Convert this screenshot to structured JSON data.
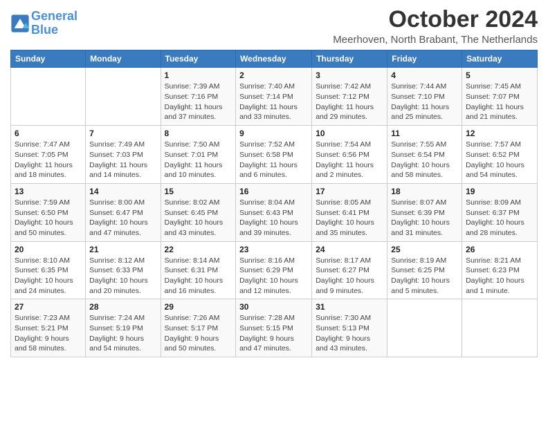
{
  "logo": {
    "line1": "General",
    "line2": "Blue"
  },
  "title": "October 2024",
  "location": "Meerhoven, North Brabant, The Netherlands",
  "days_header": [
    "Sunday",
    "Monday",
    "Tuesday",
    "Wednesday",
    "Thursday",
    "Friday",
    "Saturday"
  ],
  "weeks": [
    [
      {
        "num": "",
        "detail": ""
      },
      {
        "num": "",
        "detail": ""
      },
      {
        "num": "1",
        "detail": "Sunrise: 7:39 AM\nSunset: 7:16 PM\nDaylight: 11 hours and 37 minutes."
      },
      {
        "num": "2",
        "detail": "Sunrise: 7:40 AM\nSunset: 7:14 PM\nDaylight: 11 hours and 33 minutes."
      },
      {
        "num": "3",
        "detail": "Sunrise: 7:42 AM\nSunset: 7:12 PM\nDaylight: 11 hours and 29 minutes."
      },
      {
        "num": "4",
        "detail": "Sunrise: 7:44 AM\nSunset: 7:10 PM\nDaylight: 11 hours and 25 minutes."
      },
      {
        "num": "5",
        "detail": "Sunrise: 7:45 AM\nSunset: 7:07 PM\nDaylight: 11 hours and 21 minutes."
      }
    ],
    [
      {
        "num": "6",
        "detail": "Sunrise: 7:47 AM\nSunset: 7:05 PM\nDaylight: 11 hours and 18 minutes."
      },
      {
        "num": "7",
        "detail": "Sunrise: 7:49 AM\nSunset: 7:03 PM\nDaylight: 11 hours and 14 minutes."
      },
      {
        "num": "8",
        "detail": "Sunrise: 7:50 AM\nSunset: 7:01 PM\nDaylight: 11 hours and 10 minutes."
      },
      {
        "num": "9",
        "detail": "Sunrise: 7:52 AM\nSunset: 6:58 PM\nDaylight: 11 hours and 6 minutes."
      },
      {
        "num": "10",
        "detail": "Sunrise: 7:54 AM\nSunset: 6:56 PM\nDaylight: 11 hours and 2 minutes."
      },
      {
        "num": "11",
        "detail": "Sunrise: 7:55 AM\nSunset: 6:54 PM\nDaylight: 10 hours and 58 minutes."
      },
      {
        "num": "12",
        "detail": "Sunrise: 7:57 AM\nSunset: 6:52 PM\nDaylight: 10 hours and 54 minutes."
      }
    ],
    [
      {
        "num": "13",
        "detail": "Sunrise: 7:59 AM\nSunset: 6:50 PM\nDaylight: 10 hours and 50 minutes."
      },
      {
        "num": "14",
        "detail": "Sunrise: 8:00 AM\nSunset: 6:47 PM\nDaylight: 10 hours and 47 minutes."
      },
      {
        "num": "15",
        "detail": "Sunrise: 8:02 AM\nSunset: 6:45 PM\nDaylight: 10 hours and 43 minutes."
      },
      {
        "num": "16",
        "detail": "Sunrise: 8:04 AM\nSunset: 6:43 PM\nDaylight: 10 hours and 39 minutes."
      },
      {
        "num": "17",
        "detail": "Sunrise: 8:05 AM\nSunset: 6:41 PM\nDaylight: 10 hours and 35 minutes."
      },
      {
        "num": "18",
        "detail": "Sunrise: 8:07 AM\nSunset: 6:39 PM\nDaylight: 10 hours and 31 minutes."
      },
      {
        "num": "19",
        "detail": "Sunrise: 8:09 AM\nSunset: 6:37 PM\nDaylight: 10 hours and 28 minutes."
      }
    ],
    [
      {
        "num": "20",
        "detail": "Sunrise: 8:10 AM\nSunset: 6:35 PM\nDaylight: 10 hours and 24 minutes."
      },
      {
        "num": "21",
        "detail": "Sunrise: 8:12 AM\nSunset: 6:33 PM\nDaylight: 10 hours and 20 minutes."
      },
      {
        "num": "22",
        "detail": "Sunrise: 8:14 AM\nSunset: 6:31 PM\nDaylight: 10 hours and 16 minutes."
      },
      {
        "num": "23",
        "detail": "Sunrise: 8:16 AM\nSunset: 6:29 PM\nDaylight: 10 hours and 12 minutes."
      },
      {
        "num": "24",
        "detail": "Sunrise: 8:17 AM\nSunset: 6:27 PM\nDaylight: 10 hours and 9 minutes."
      },
      {
        "num": "25",
        "detail": "Sunrise: 8:19 AM\nSunset: 6:25 PM\nDaylight: 10 hours and 5 minutes."
      },
      {
        "num": "26",
        "detail": "Sunrise: 8:21 AM\nSunset: 6:23 PM\nDaylight: 10 hours and 1 minute."
      }
    ],
    [
      {
        "num": "27",
        "detail": "Sunrise: 7:23 AM\nSunset: 5:21 PM\nDaylight: 9 hours and 58 minutes."
      },
      {
        "num": "28",
        "detail": "Sunrise: 7:24 AM\nSunset: 5:19 PM\nDaylight: 9 hours and 54 minutes."
      },
      {
        "num": "29",
        "detail": "Sunrise: 7:26 AM\nSunset: 5:17 PM\nDaylight: 9 hours and 50 minutes."
      },
      {
        "num": "30",
        "detail": "Sunrise: 7:28 AM\nSunset: 5:15 PM\nDaylight: 9 hours and 47 minutes."
      },
      {
        "num": "31",
        "detail": "Sunrise: 7:30 AM\nSunset: 5:13 PM\nDaylight: 9 hours and 43 minutes."
      },
      {
        "num": "",
        "detail": ""
      },
      {
        "num": "",
        "detail": ""
      }
    ]
  ]
}
